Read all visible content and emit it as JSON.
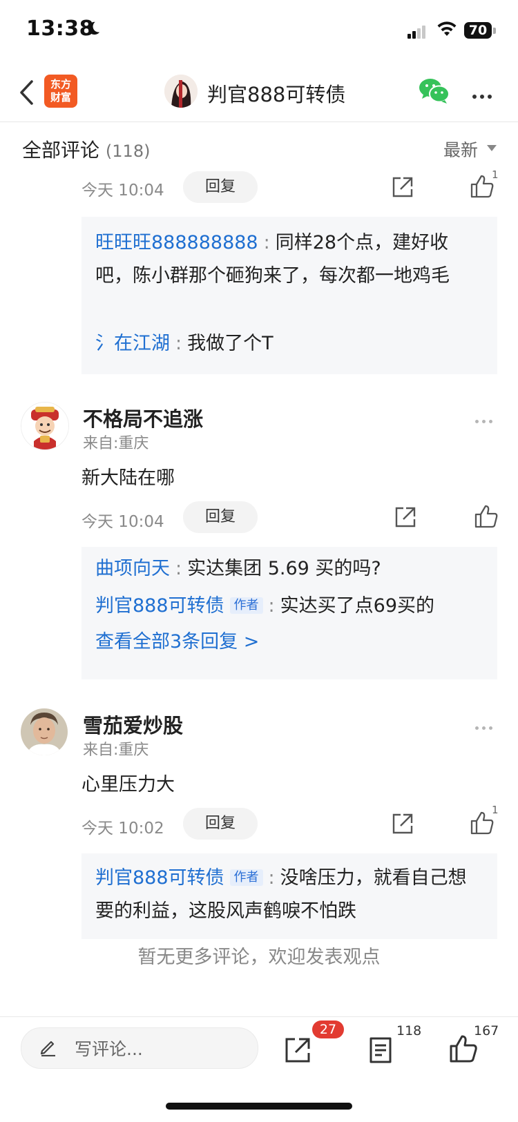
{
  "status_bar": {
    "time": "13:38",
    "battery": "70"
  },
  "nav": {
    "logo_line1": "东方",
    "logo_line2": "财富",
    "title": "判官888可转债"
  },
  "header": {
    "title": "全部评论",
    "count": "(118)",
    "sort": "最新"
  },
  "top_comment": {
    "time": "今天 10:04",
    "reply_label": "回复",
    "like_count": "1",
    "replies": [
      {
        "user": "旺旺旺888888888",
        "text": "同样28个点，建好收吧，陈小群那个砸狗来了，每次都一地鸡毛"
      },
      {
        "user": "氵在江湖",
        "text": "我做了个T"
      }
    ]
  },
  "comments": [
    {
      "name": "不格局不追涨",
      "location": "来自:重庆",
      "content": "新大陆在哪",
      "time": "今天 10:04",
      "reply_label": "回复",
      "like_count": "",
      "replies": [
        {
          "user": "曲项向天",
          "text": "实达集团  5.69 买的吗?"
        },
        {
          "user": "判官888可转债",
          "tag": "作者",
          "text": "实达买了点69买的"
        }
      ],
      "view_all": "查看全部3条回复 >"
    },
    {
      "name": "雪茄爱炒股",
      "location": "来自:重庆",
      "content": "心里压力大",
      "time": "今天 10:02",
      "reply_label": "回复",
      "like_count": "1",
      "replies": [
        {
          "user": "判官888可转债",
          "tag": "作者",
          "text": "没啥压力，就看自己想要的利益，这股风声鹤唳不怕跌"
        }
      ]
    }
  ],
  "footer_note": "暂无更多评论，欢迎发表观点",
  "bottom_bar": {
    "placeholder": "写评论...",
    "share_badge": "27",
    "comments_count": "118",
    "likes_count": "167"
  },
  "colors": {
    "link_blue": "#1f6fd1",
    "brand_orange": "#f25a23",
    "badge_red": "#e23b31",
    "wechat_green": "#36c25a"
  }
}
